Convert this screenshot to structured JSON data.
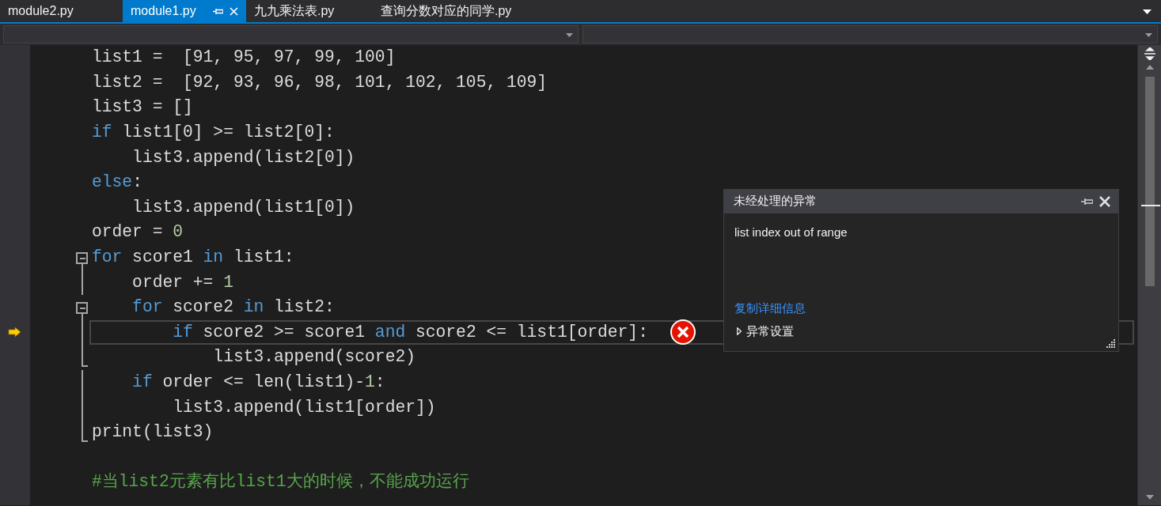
{
  "tabs": [
    {
      "label": "module2.py",
      "selected": false
    },
    {
      "label": "module1.py",
      "selected": true
    },
    {
      "label": "九九乘法表.py",
      "selected": false
    },
    {
      "label": "查询分数对应的同学.py",
      "selected": false
    }
  ],
  "code_lines": [
    {
      "tokens": [
        {
          "kind": "txt",
          "text": "list1 =  [91, 95, 97, 99, 100]"
        }
      ]
    },
    {
      "tokens": [
        {
          "kind": "txt",
          "text": "list2 =  [92, 93, 96, 98, 101, 102, 105, 109]"
        }
      ]
    },
    {
      "tokens": [
        {
          "kind": "txt",
          "text": "list3 = []"
        }
      ]
    },
    {
      "tokens": [
        {
          "kind": "kw",
          "text": "if"
        },
        {
          "kind": "txt",
          "text": " list1[0] >= list2[0]:"
        }
      ]
    },
    {
      "tokens": [
        {
          "kind": "txt",
          "text": "    list3.append(list2[0])"
        }
      ]
    },
    {
      "tokens": [
        {
          "kind": "kw",
          "text": "else"
        },
        {
          "kind": "txt",
          "text": ":"
        }
      ]
    },
    {
      "tokens": [
        {
          "kind": "txt",
          "text": "    list3.append(list1[0])"
        }
      ]
    },
    {
      "tokens": [
        {
          "kind": "txt",
          "text": "order = "
        },
        {
          "kind": "num",
          "text": "0"
        }
      ]
    },
    {
      "fold_toggle": true,
      "tokens": [
        {
          "kind": "kw",
          "text": "for"
        },
        {
          "kind": "txt",
          "text": " score1 "
        },
        {
          "kind": "kw",
          "text": "in"
        },
        {
          "kind": "txt",
          "text": " list1:"
        }
      ]
    },
    {
      "fold_guide": true,
      "tokens": [
        {
          "kind": "txt",
          "text": "    order += "
        },
        {
          "kind": "num",
          "text": "1"
        }
      ]
    },
    {
      "fold_toggle": true,
      "tokens": [
        {
          "kind": "kw",
          "text": "    for"
        },
        {
          "kind": "txt",
          "text": " score2 "
        },
        {
          "kind": "kw",
          "text": "in"
        },
        {
          "kind": "txt",
          "text": " list2:"
        }
      ]
    },
    {
      "fold_guide": true,
      "current": true,
      "exception": true,
      "tokens": [
        {
          "kind": "kw",
          "text": "        if"
        },
        {
          "kind": "txt",
          "text": " score2 >= score1 "
        },
        {
          "kind": "kw",
          "text": "and"
        },
        {
          "kind": "txt",
          "text": " score2 <= list1[order]:"
        }
      ]
    },
    {
      "fold_guide": true,
      "fold_end": true,
      "tokens": [
        {
          "kind": "txt",
          "text": "            list3.append(score2)"
        }
      ]
    },
    {
      "fold_guide": true,
      "tokens": [
        {
          "kind": "kw",
          "text": "    if"
        },
        {
          "kind": "txt",
          "text": " order <= len(list1)-"
        },
        {
          "kind": "num",
          "text": "1"
        },
        {
          "kind": "txt",
          "text": ":"
        }
      ]
    },
    {
      "fold_guide": true,
      "tokens": [
        {
          "kind": "txt",
          "text": "        list3.append(list1[order])"
        }
      ]
    },
    {
      "fold_guide": true,
      "fold_end": true,
      "blank_after": true,
      "tokens": [
        {
          "kind": "txt",
          "text": "print(list3)"
        }
      ]
    },
    {
      "tokens": [
        {
          "kind": "cmt",
          "text": "#当list2元素有比list1大的时候，不能成功运行"
        }
      ]
    }
  ],
  "exception_popup": {
    "title": "未经处理的异常",
    "message": "list index out of range",
    "link": "复制详细信息",
    "settings": "异常设置"
  }
}
